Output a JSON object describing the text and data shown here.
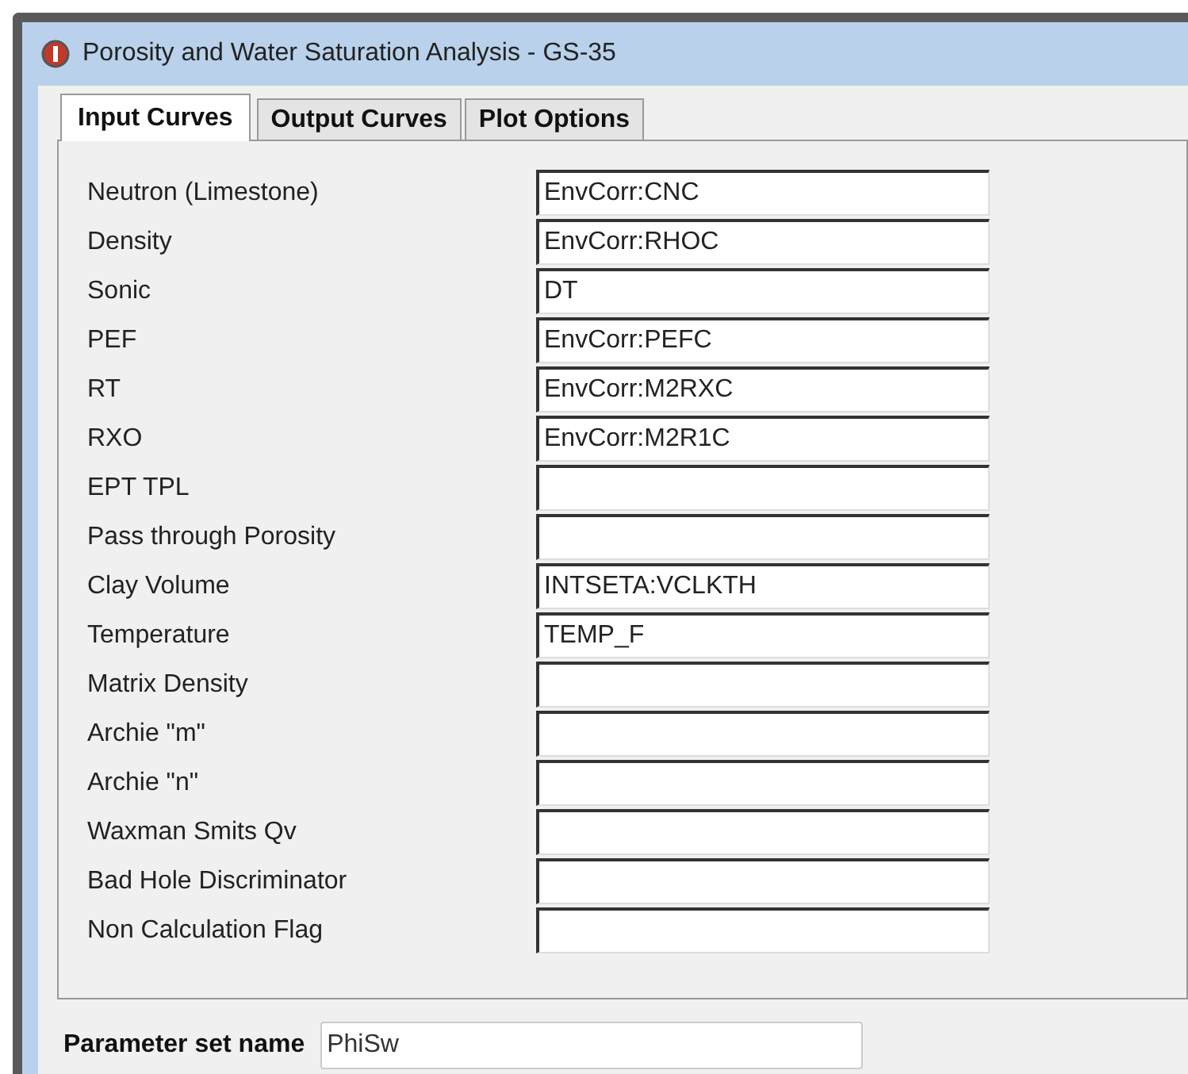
{
  "window": {
    "title": "Porosity and Water Saturation Analysis - GS-35"
  },
  "tabs": [
    {
      "label": "Input Curves",
      "selected": true
    },
    {
      "label": "Output Curves",
      "selected": false
    },
    {
      "label": "Plot Options",
      "selected": false
    }
  ],
  "fields": [
    {
      "label": "Neutron (Limestone)",
      "value": "EnvCorr:CNC"
    },
    {
      "label": "Density",
      "value": "EnvCorr:RHOC"
    },
    {
      "label": "Sonic",
      "value": "DT"
    },
    {
      "label": "PEF",
      "value": "EnvCorr:PEFC"
    },
    {
      "label": "RT",
      "value": "EnvCorr:M2RXC"
    },
    {
      "label": "RXO",
      "value": "EnvCorr:M2R1C"
    },
    {
      "label": "EPT TPL"
    },
    {
      "label": "Pass through Porosity"
    },
    {
      "label": "Clay Volume",
      "value": "INTSETA:VCLKTH"
    },
    {
      "label": "Temperature",
      "value": "TEMP_F"
    },
    {
      "label": "Matrix Density"
    },
    {
      "label": "Archie \"m\""
    },
    {
      "label": "Archie \"n\""
    },
    {
      "label": "Waxman Smits Qv"
    },
    {
      "label": "Bad Hole Discriminator"
    },
    {
      "label": "Non Calculation Flag"
    }
  ],
  "parameter_set": {
    "label": "Parameter set name",
    "value": "PhiSw"
  }
}
